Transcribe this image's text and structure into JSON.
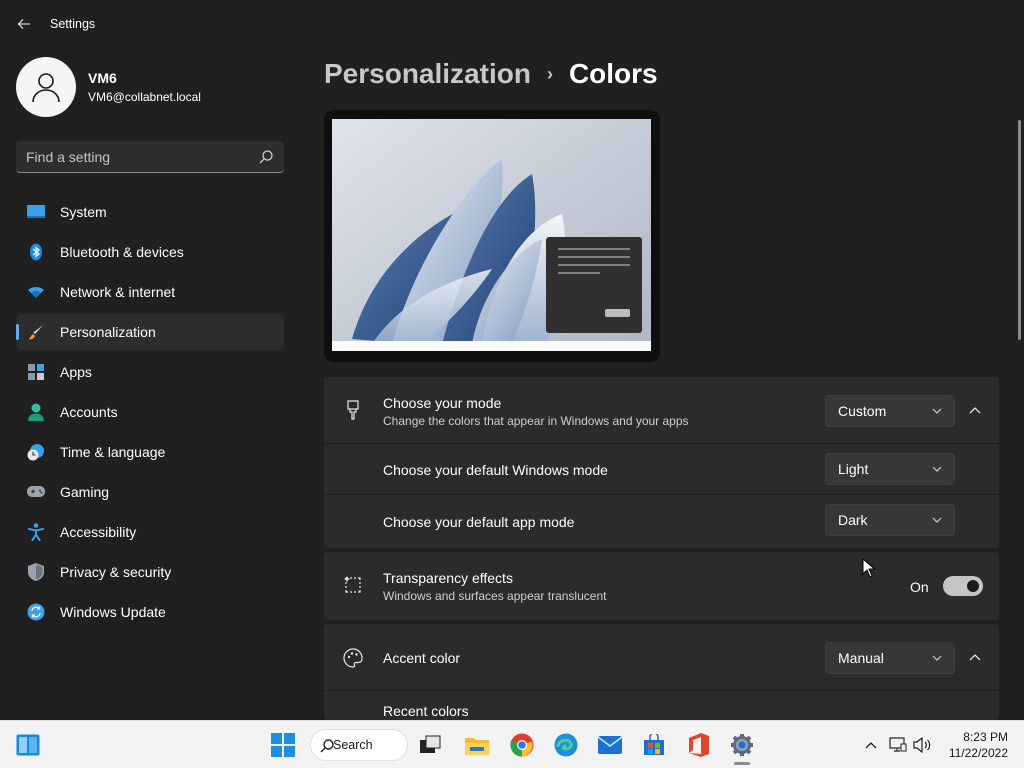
{
  "window": {
    "title": "Settings"
  },
  "profile": {
    "name": "VM6",
    "email": "VM6@collabnet.local"
  },
  "search": {
    "placeholder": "Find a setting"
  },
  "sidebar": {
    "items": [
      {
        "label": "System",
        "icon": "system-icon"
      },
      {
        "label": "Bluetooth & devices",
        "icon": "bluetooth-icon"
      },
      {
        "label": "Network & internet",
        "icon": "wifi-icon"
      },
      {
        "label": "Personalization",
        "icon": "paintbrush-icon",
        "active": true
      },
      {
        "label": "Apps",
        "icon": "apps-icon"
      },
      {
        "label": "Accounts",
        "icon": "person-icon"
      },
      {
        "label": "Time & language",
        "icon": "clock-globe-icon"
      },
      {
        "label": "Gaming",
        "icon": "gamepad-icon"
      },
      {
        "label": "Accessibility",
        "icon": "accessibility-icon"
      },
      {
        "label": "Privacy & security",
        "icon": "shield-icon"
      },
      {
        "label": "Windows Update",
        "icon": "update-icon"
      }
    ]
  },
  "breadcrumb": {
    "parent": "Personalization",
    "separator": "›",
    "current": "Colors"
  },
  "mode": {
    "title": "Choose your mode",
    "subtitle": "Change the colors that appear in Windows and your apps",
    "value": "Custom",
    "windows_mode_label": "Choose your default Windows mode",
    "windows_mode_value": "Light",
    "app_mode_label": "Choose your default app mode",
    "app_mode_value": "Dark"
  },
  "transparency": {
    "title": "Transparency effects",
    "subtitle": "Windows and surfaces appear translucent",
    "state_label": "On",
    "enabled": true
  },
  "accent": {
    "title": "Accent color",
    "value": "Manual",
    "recent_label": "Recent colors"
  },
  "taskbar": {
    "search_label": "Search",
    "time": "8:23 PM",
    "date": "11/22/2022"
  },
  "colors": {
    "accent": "#6aa8e8",
    "background": "#202020",
    "card": "#2b2b2b"
  }
}
